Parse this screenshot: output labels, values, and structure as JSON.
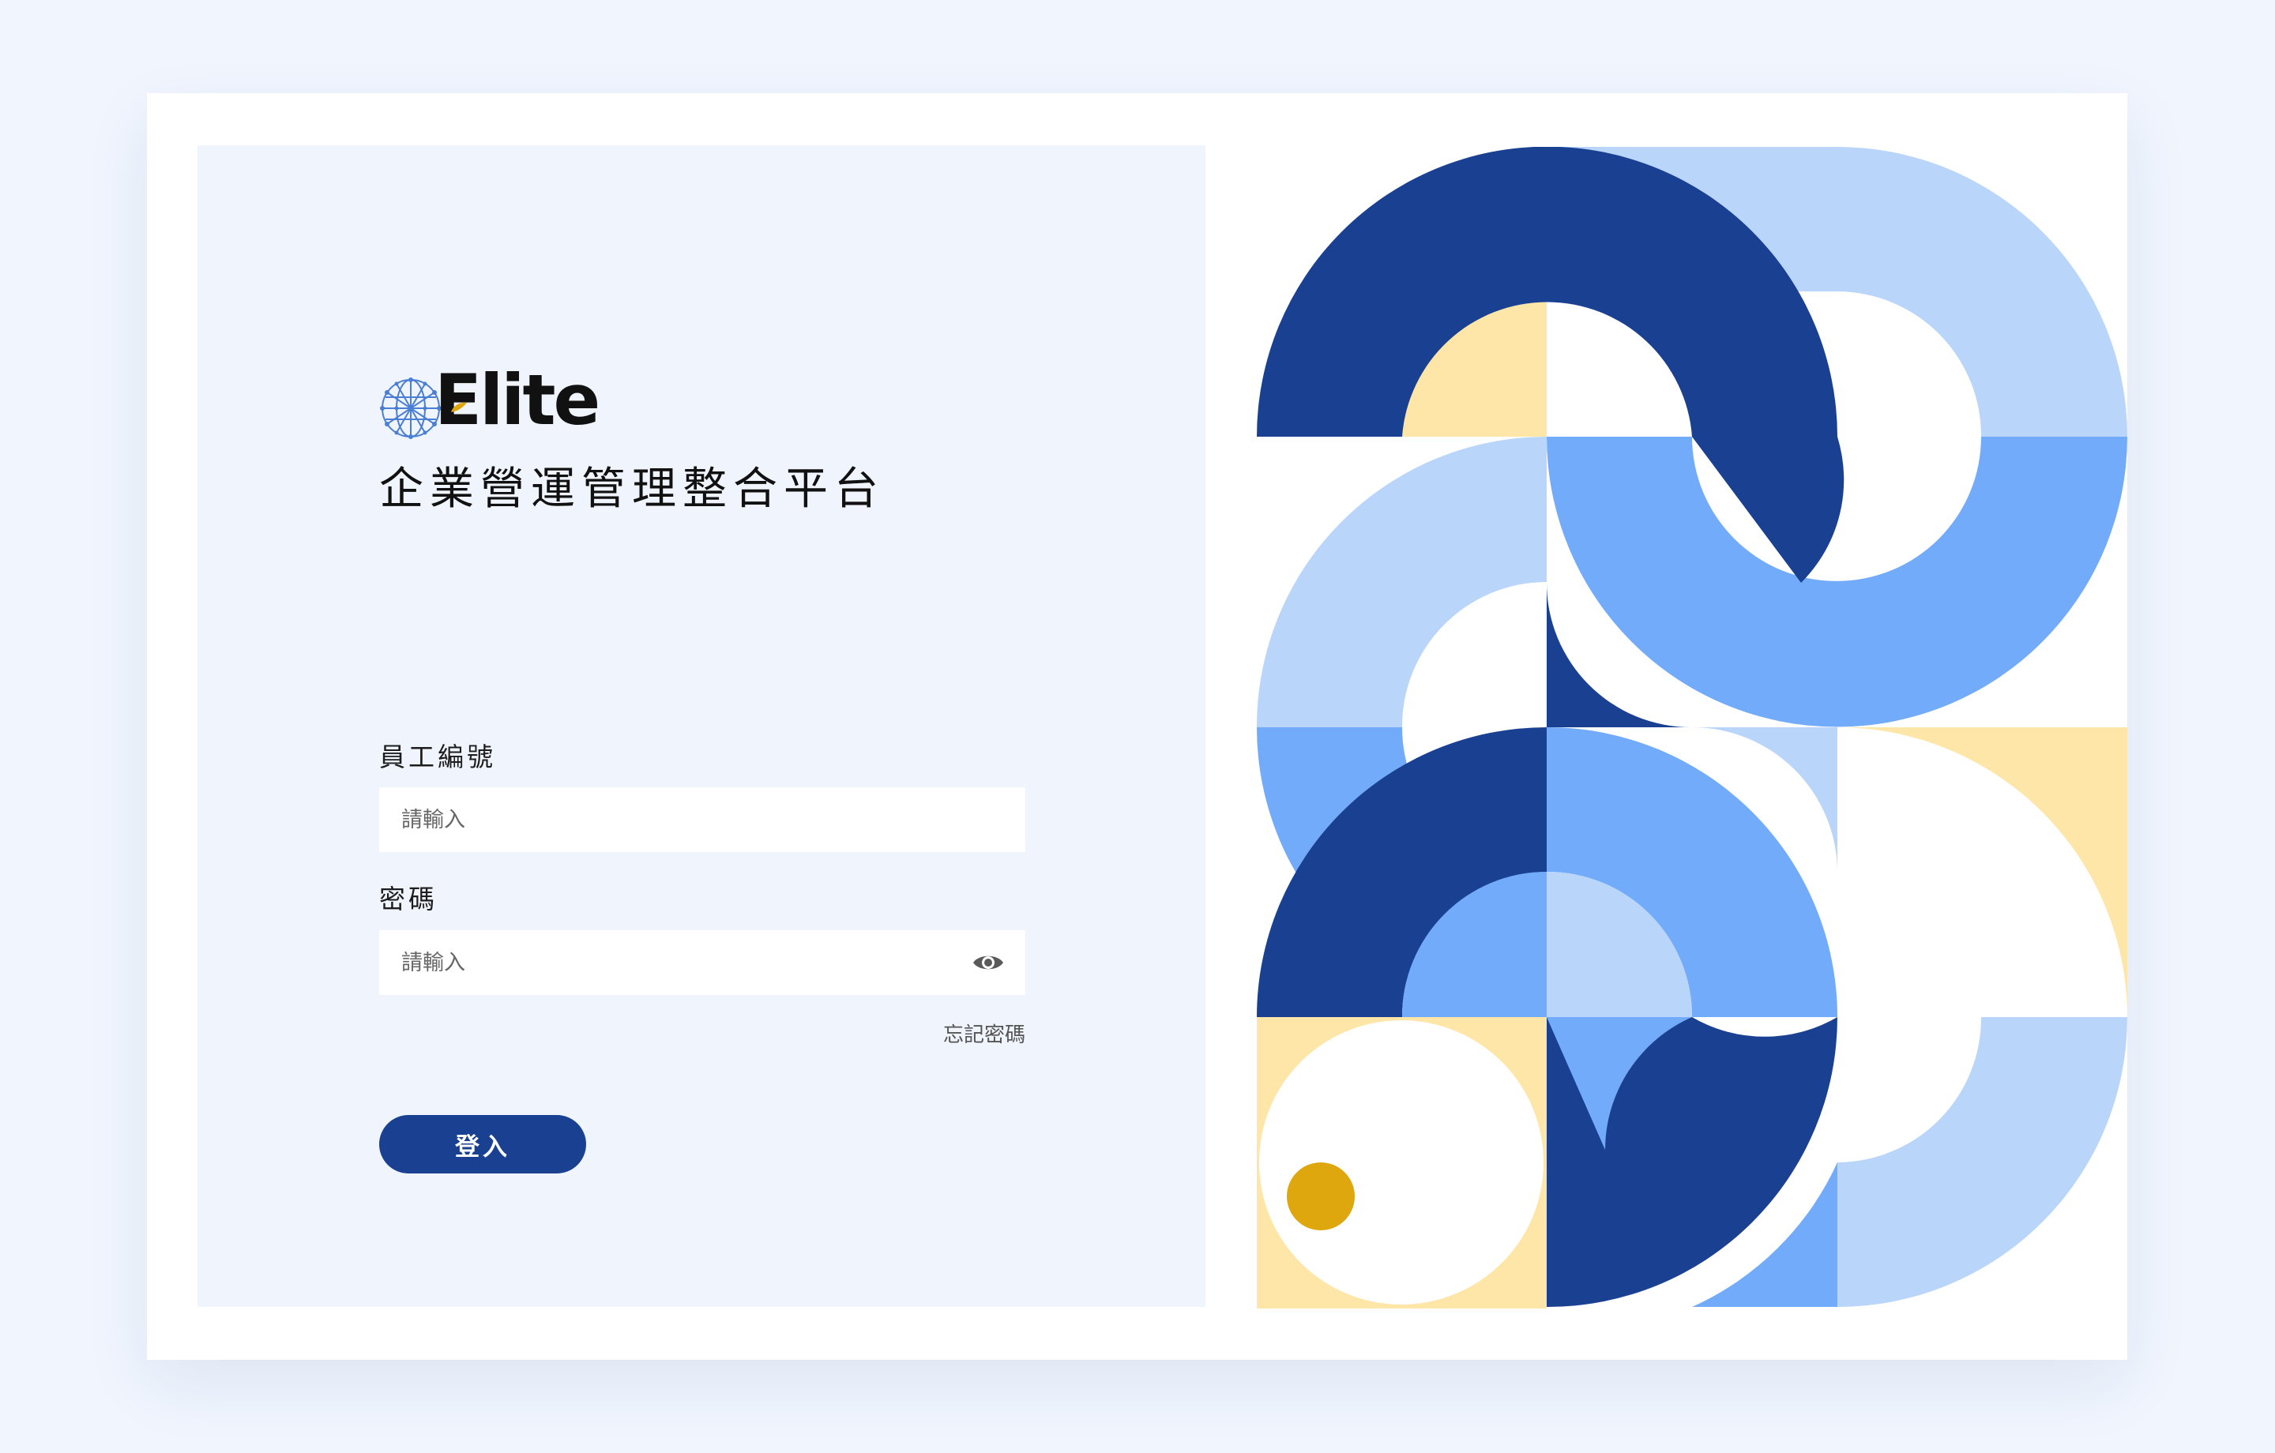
{
  "brand": {
    "name": "Elite",
    "platform_title": "企業營運管理整合平台",
    "logo_icon": "network-globe-icon"
  },
  "form": {
    "employee_id": {
      "label": "員工編號",
      "placeholder": "請輸入",
      "value": ""
    },
    "password": {
      "label": "密碼",
      "placeholder": "請輸入",
      "value": "",
      "toggle_icon": "eye-icon"
    },
    "forgot_password": "忘記密碼",
    "login_button": "登入"
  },
  "colors": {
    "primary": "#1a4191",
    "light_blue": "#bad5fa",
    "mid_blue": "#72abf9",
    "yellow": "#fde6a8",
    "gold": "#dea70e",
    "panel_bg": "#f0f4fc",
    "page_bg": "#f0f5fe"
  }
}
